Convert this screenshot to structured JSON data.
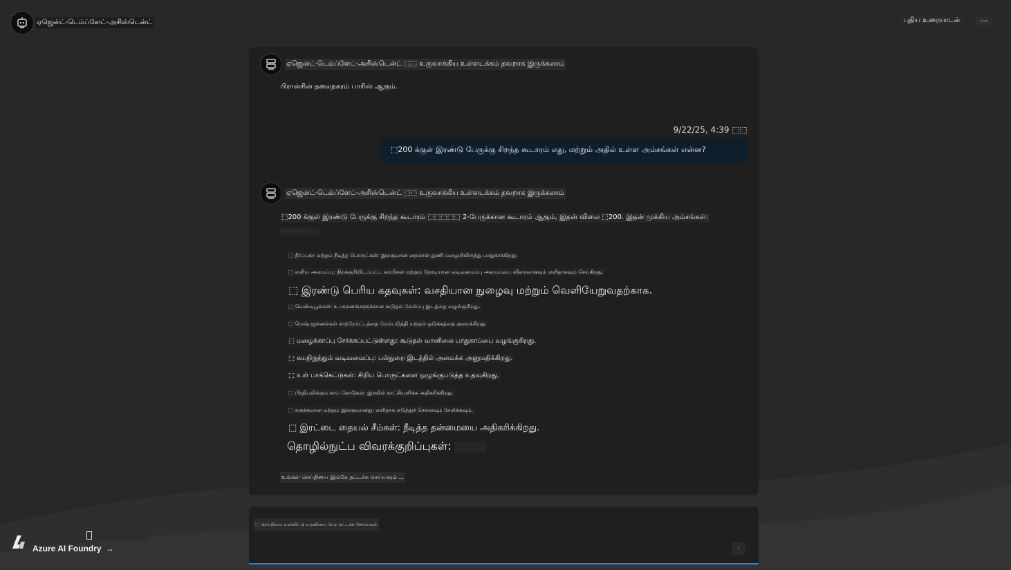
{
  "header": {
    "app_title": "ஏஜென்ட்-டெம்ப்ளேட்-அசிஸ்டென்ட்",
    "new_chat_label": "புதிய உரையாடல்",
    "more_label": "..."
  },
  "messages": {
    "first": {
      "bot_label": "ஏஜென்ட்-டெம்ப்ளேட்-அசிஸ்டென்ட் ⬚⬚ உருவாக்கிய உள்ளடக்கம் தவறாக இருக்கலாம்",
      "text": "பிரான்சின் தலைநகரம் பாரிஸ் ஆகும்."
    },
    "user": {
      "timestamp": "9/22/25, 4:39 ⬚⬚",
      "text": "⬚200 க்குள் இரண்டு பேருக்கு சிறந்த கூடாரம் எது, மற்றும் அதில் உள்ள அம்சங்கள் என்ன?"
    },
    "second": {
      "bot_label": "ஏஜென்ட்-டெம்ப்ளேட்-அசிஸ்டென்ட் ⬚⬚ உருவாக்கிய உள்ளடக்கம் தவறாக இருக்கலாம்",
      "intro": "⬚200 க்குள் இரண்டு பேருக்கு சிறந்த கூடாரம் ⬚⬚⬚⬚⬚ 2-பேருக்கான கூடாரம் ஆகும், இதன் விலை ⬚200. இதன் முக்கிய அம்சங்கள்:",
      "faint": "· · · · · · · · · ·",
      "features": [
        "⬚ நீர்ப்புகா மற்றும் நீடித்த பொருட்கள்: இலகுவான நைலான் துணி மழையிலிருந்து பாதுகாக்கிறது.",
        "⬚ எளிய அமைப்பு: நிறக்குறியிடப்பட்ட கம்பிகள் மற்றும் நேரடியான வடிவமைப்பு அமைப்பை விரைவாகவும் எளிதாகவும் செய்கிறது.",
        "⬚ இரண்டு பெரிய கதவுகள்: வசதியான நுழைவு மற்றும் வெளியேறுவதற்காக.",
        "⬚ வெஸ்டிபூல்கள்: உபகரணங்களுக்கான கூடுதல் சேமிப்பு இடத்தை வழங்குகிறது.",
        "⬚ மெஷ் ஜன்னல்கள் காற்றோட்டத்தை மேம்படுத்தி மற்றும் ஒடுக்கத்தை குறைக்கிறது.",
        "⬚ மழைக்காப்பு சேர்க்கப்பட்டுள்ளது: கூடுதல் வானிலை பாதுகாப்பை வழங்குகிறது.",
        "⬚ சுயநிறுத்தும் வடிவமைப்பு: பல்துறை இடத்தில் அமைக்க அனுமதிக்கிறது.",
        "⬚ உள் பாக்கெட்டுகள்: சிறிய பொருட்களை ஒழுங்குபடுத்த உதவுகிறது.",
        "⬚ பிரதிபலிக்கும் காய் கோடுகள்: இரவில் காட்சியளிக்க அதிகரிக்கிறது.",
        "⬚ சுருக்கமான மற்றும் இலகுவானது: எளிதாக எடுத்துச் செல்லவும் சேமிக்கவும்.",
        "⬚ இரட்டை தையல் சீம்கள்: நீடித்த தன்மையை அதிகரிக்கிறது."
      ],
      "tech_specs": "தொழில்நுட்ப விவரக்குறிப்புகள்:",
      "typing_hint": "உங்கள் செய்தியை இங்கே தட்டச்சு செய்யவும் ..."
    }
  },
  "input": {
    "placeholder": "⬚ செய்தியை உள்ளிட்டு உதவியை பெற தட்டச்சு செய்யவும்",
    "send_label": "›"
  },
  "footer": {
    "link_label": "Azure AI Foundry",
    "arrow_glyph": "→"
  },
  "colors": {
    "background": "#282828",
    "panel": "#1f1f1f",
    "user_bubble": "#0f1e2b",
    "input_accent": "#3a7bd5"
  }
}
